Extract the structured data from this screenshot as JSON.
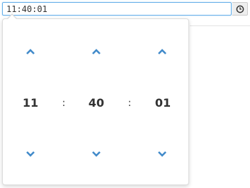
{
  "time_input": {
    "value": "11:40:01"
  },
  "clock_button": {
    "icon": "clock-icon"
  },
  "picker": {
    "hour": "11",
    "minute": "40",
    "second": "01",
    "separator": ":",
    "increment_icon": "chevron-up-icon",
    "decrement_icon": "chevron-down-icon"
  },
  "colors": {
    "accent": "#428bca",
    "focus_border": "#66afe9",
    "text": "#333333"
  }
}
